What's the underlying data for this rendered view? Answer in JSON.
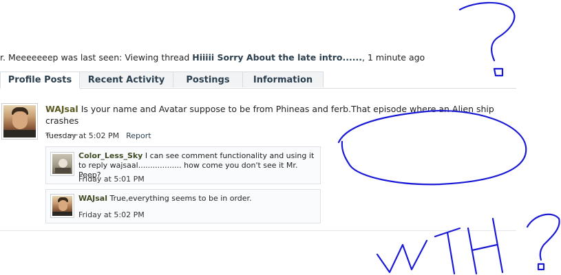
{
  "last_seen": {
    "prefix": "r. Meeeeeeep was last seen: Viewing thread ",
    "thread": "Hiiiii Sorry About the late intro......",
    "suffix": ", 1 minute ago"
  },
  "tabs": [
    {
      "label": "Profile Posts"
    },
    {
      "label": "Recent Activity"
    },
    {
      "label": "Postings"
    },
    {
      "label": "Information"
    }
  ],
  "post": {
    "author": "WAJsal",
    "text": " Is your name and Avatar suppose to be from Phineas and ferb.That episode where an Alien ship crashes",
    "text2": "............",
    "time": "Tuesday at 5:02 PM",
    "report": "Report"
  },
  "comments": [
    {
      "author": "Color_Less_Sky",
      "text": " I can see comment functionality and using it to reply wajsaal.................. how come you don't see it Mr. Peep?",
      "time": "Friday at 5:01 PM"
    },
    {
      "author": "WAJsal",
      "text": " True,everything seems to be in order.",
      "time": "Friday at 5:02 PM"
    }
  ],
  "annotations": {
    "color": "#1a1ad6",
    "question_mark_1": "?",
    "letters": "WTH",
    "question_mark_2": "?"
  }
}
